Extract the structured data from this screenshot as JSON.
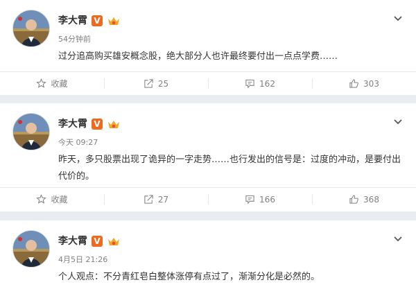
{
  "posts": [
    {
      "author": "李大霄",
      "time": "54分钟前",
      "text": "过分追高购买雄安概念股，绝大部分人也许最终要付出一点点学费……",
      "favorite_label": "收藏",
      "repost_count": "25",
      "comment_count": "162",
      "like_count": "303"
    },
    {
      "author": "李大霄",
      "time": "今天 09:27",
      "text": "昨天，多只股票出现了诡异的一字走势……也行发出的信号是：过度的冲动，是要付出代价的。",
      "favorite_label": "收藏",
      "repost_count": "27",
      "comment_count": "166",
      "like_count": "368"
    },
    {
      "author": "李大霄",
      "time": "4月5日 21:26",
      "text": "个人观点：不分青红皂白整体涨停有点过了，渐渐分化是必然的。"
    }
  ],
  "badges": {
    "verified": "V"
  },
  "icons": {
    "favorite": "star-icon",
    "repost": "repost-icon",
    "comment": "comment-icon",
    "like": "thumbs-up-icon",
    "menu": "chevron-down-icon",
    "member": "crown-icon"
  },
  "colors": {
    "background": "#e9edf2",
    "verified": "#ef6a1f",
    "member": "#f5a623",
    "muted": "#808080"
  }
}
